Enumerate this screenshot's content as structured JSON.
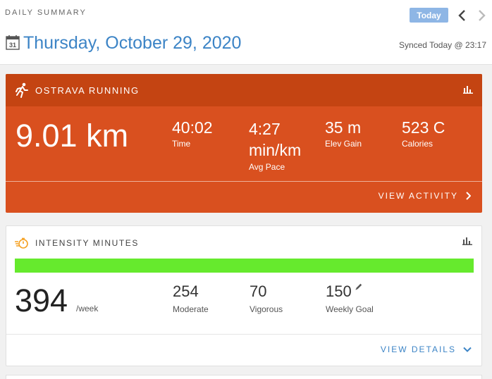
{
  "header": {
    "section_label": "DAILY SUMMARY",
    "today_label": "Today",
    "date": "Thursday, October 29, 2020",
    "calendar_day": "31",
    "synced": "Synced Today @ 23:17"
  },
  "activity": {
    "title": "OSTRAVA RUNNING",
    "distance": "9.01 km",
    "time_value": "40:02",
    "time_label": "Time",
    "pace_value_1": "4:27",
    "pace_value_2": "min/km",
    "pace_label": "Avg Pace",
    "elev_value": "35 m",
    "elev_label": "Elev Gain",
    "calories_value": "523 C",
    "calories_label": "Calories",
    "view_label": "VIEW ACTIVITY",
    "card_color": "#d9501f",
    "header_color": "#c44412"
  },
  "intensity": {
    "title": "INTENSITY MINUTES",
    "progress_percent": 100,
    "progress_color": "#66ea2d",
    "total": "394",
    "unit": "/week",
    "moderate_value": "254",
    "moderate_label": "Moderate",
    "vigorous_value": "70",
    "vigorous_label": "Vigorous",
    "goal_value": "150",
    "goal_label": "Weekly Goal",
    "view_label": "VIEW DETAILS"
  },
  "icons": {
    "calendar": "calendar-icon",
    "prev": "chevron-left-icon",
    "next": "chevron-right-icon",
    "running": "running-icon",
    "chart": "bar-chart-icon",
    "stopwatch": "stopwatch-icon",
    "edit": "pencil-icon",
    "expand": "chevron-down-icon"
  }
}
